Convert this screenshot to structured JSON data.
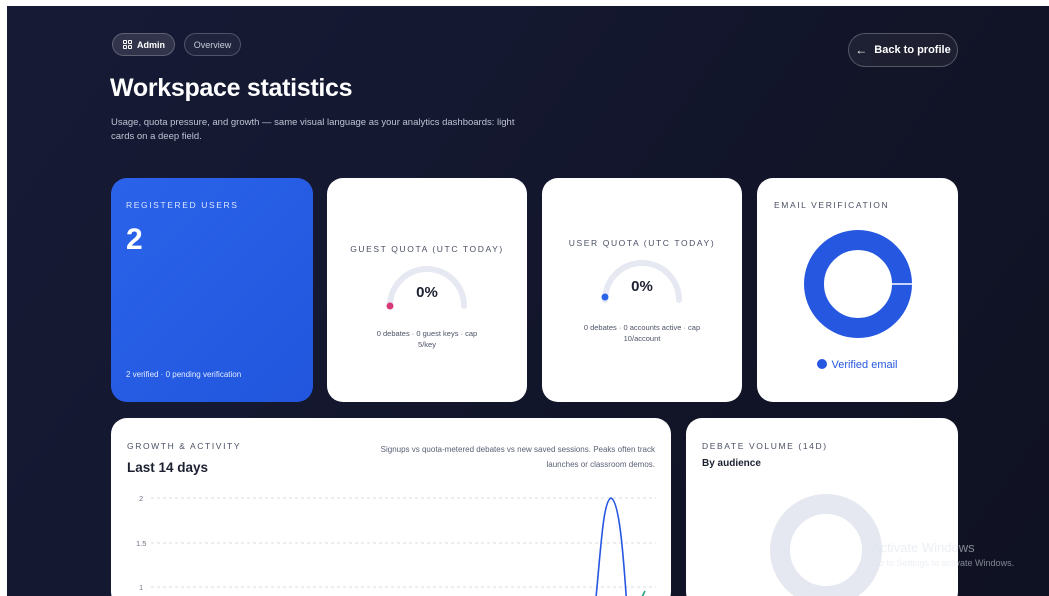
{
  "nav": {
    "admin_label": "Admin",
    "overview_label": "Overview",
    "back_label": "Back to profile",
    "back_icon": "arrow-left-icon"
  },
  "header": {
    "title": "Workspace statistics",
    "subtitle": "Usage, quota pressure, and growth — same visual language as your analytics dashboards: light cards on a deep field."
  },
  "cards": {
    "registered": {
      "label": "REGISTERED USERS",
      "count": "2",
      "footer": "2 verified · 0 pending verification"
    },
    "guest_quota": {
      "label": "GUEST QUOTA (UTC TODAY)",
      "value": "0%",
      "note": "0 debates · 0 guest keys · cap 5/key",
      "percent": 0,
      "marker_color": "#d63a7a"
    },
    "user_quota": {
      "label": "USER QUOTA (UTC TODAY)",
      "value": "0%",
      "note": "0 debates · 0 accounts active · cap 10/account",
      "percent": 0,
      "marker_color": "#2a63ea"
    },
    "email_verification": {
      "label": "EMAIL VERIFICATION",
      "legend": "Verified email",
      "verified_fraction": 1.0,
      "color": "#2557e0"
    },
    "growth": {
      "label": "GROWTH & ACTIVITY",
      "title": "Last 14 days",
      "description": "Signups vs quota-metered debates vs new saved sessions. Peaks often track launches or classroom demos.",
      "y_ticks": [
        "2",
        "1.5",
        "1"
      ]
    },
    "debate_volume": {
      "label": "DEBATE VOLUME (14D)",
      "subtitle": "By audience"
    }
  },
  "watermark": {
    "line1": "Activate Windows",
    "line2": "Go to Settings to activate Windows."
  },
  "colors": {
    "background": "#141830",
    "accent": "#2a63ea",
    "guest_marker": "#d63a7a",
    "line_signups": "#2557e0",
    "line_sessions": "#1fa37a"
  }
}
